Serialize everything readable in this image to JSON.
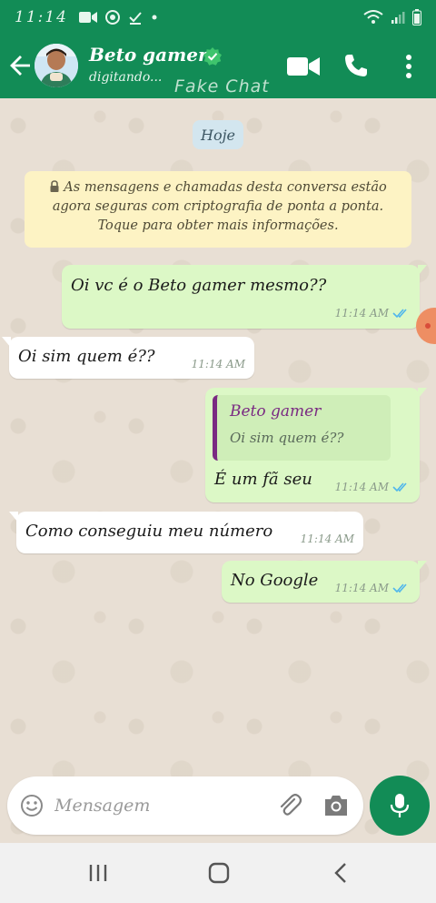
{
  "status_bar": {
    "time": "11:14"
  },
  "header": {
    "contact_name": "Beto gamer",
    "status": "digitando...",
    "watermark": "Fake Chat"
  },
  "chat": {
    "date_chip": "Hoje",
    "encryption_notice": "As mensagens e chamadas desta conversa estão agora seguras com criptografia de ponta a ponta. Toque para obter mais informações.",
    "messages": [
      {
        "direction": "out",
        "text": "Oi vc é o Beto gamer mesmo??",
        "time": "11:14 AM"
      },
      {
        "direction": "in",
        "text": "Oi sim quem é??",
        "time": "11:14 AM"
      },
      {
        "direction": "out",
        "quote_author": "Beto gamer",
        "quote_text": "Oi sim quem é??",
        "text": "É um fã seu",
        "time": "11:14 AM"
      },
      {
        "direction": "in",
        "text": "Como conseguiu meu número",
        "time": "11:14 AM"
      },
      {
        "direction": "out",
        "text": "No Google",
        "time": "11:14 AM"
      }
    ]
  },
  "composer": {
    "placeholder": "Mensagem"
  },
  "colors": {
    "header": "#128c56",
    "outgoing_bubble": "#dcf8c6",
    "incoming_bubble": "#ffffff",
    "chat_background": "#e8dfd4",
    "read_ticks": "#4fb6ec",
    "quote_accent": "#7a2a82"
  },
  "icons": [
    "video-camera-icon",
    "wifi-icon",
    "chrome-icon",
    "check-icon",
    "signal-icon",
    "battery-icon",
    "back-arrow-icon",
    "verified-icon",
    "video-call-icon",
    "phone-icon",
    "more-vert-icon",
    "lock-icon",
    "double-check-icon",
    "emoji-icon",
    "paperclip-icon",
    "camera-icon",
    "mic-icon",
    "recent-apps-icon",
    "home-icon",
    "nav-back-icon"
  ]
}
